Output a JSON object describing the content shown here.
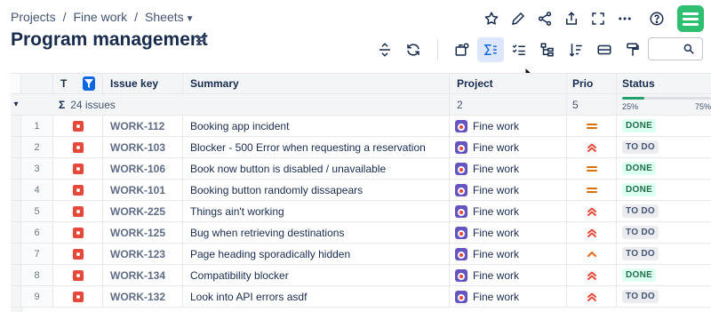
{
  "breadcrumb": {
    "items": [
      "Projects",
      "Fine work",
      "Sheets"
    ],
    "separator": "/"
  },
  "page_title": "Program management",
  "top_icons": [
    "star-icon",
    "pencil-icon",
    "share-icon",
    "export-icon",
    "fullscreen-icon",
    "more-icon",
    "help-icon"
  ],
  "toolbar_icons": [
    "collapse-rows-icon",
    "refresh-icon",
    "view-settings-icon",
    "sum-icon",
    "checklist-icon",
    "hierarchy-icon",
    "sort-icon",
    "card-view-icon",
    "format-painter-icon"
  ],
  "colors": {
    "accent": "#0c66e4",
    "done": "#216e4e",
    "bug": "#e5493a",
    "project": "#6554c0",
    "app": "#2fbf71"
  },
  "table": {
    "headers": {
      "type": "T",
      "issue_key": "Issue key",
      "summary": "Summary",
      "project": "Project",
      "prio": "Prio",
      "status": "Status"
    },
    "summary_row": {
      "sigma": "Σ",
      "count_label": "24 issues",
      "project_count": "2",
      "prio_count": "5",
      "status_progress": {
        "left_label": "25%",
        "right_label": "75%",
        "done_fraction": 0.25
      }
    },
    "rows": [
      {
        "num": "1",
        "key": "WORK-112",
        "summary": "Booking app incident",
        "project": "Fine work",
        "prio": "medium",
        "status": "DONE"
      },
      {
        "num": "2",
        "key": "WORK-103",
        "summary": "Blocker - 500 Error when requesting a reservation",
        "project": "Fine work",
        "prio": "highest",
        "status": "TO DO"
      },
      {
        "num": "3",
        "key": "WORK-106",
        "summary": "Book now button is disabled / unavailable",
        "project": "Fine work",
        "prio": "medium",
        "status": "DONE"
      },
      {
        "num": "4",
        "key": "WORK-101",
        "summary": "Booking button randomly dissapears",
        "project": "Fine work",
        "prio": "medium",
        "status": "DONE"
      },
      {
        "num": "5",
        "key": "WORK-225",
        "summary": "Things ain't working",
        "project": "Fine work",
        "prio": "highest",
        "status": "TO DO"
      },
      {
        "num": "6",
        "key": "WORK-125",
        "summary": "Bug when retrieving destinations",
        "project": "Fine work",
        "prio": "highest",
        "status": "TO DO"
      },
      {
        "num": "7",
        "key": "WORK-123",
        "summary": "Page heading sporadically hidden",
        "project": "Fine work",
        "prio": "high",
        "status": "TO DO"
      },
      {
        "num": "8",
        "key": "WORK-134",
        "summary": "Compatibility blocker",
        "project": "Fine work",
        "prio": "highest",
        "status": "DONE"
      },
      {
        "num": "9",
        "key": "WORK-132",
        "summary": "Look into API errors asdf",
        "project": "Fine work",
        "prio": "highest",
        "status": "TO DO"
      }
    ]
  }
}
